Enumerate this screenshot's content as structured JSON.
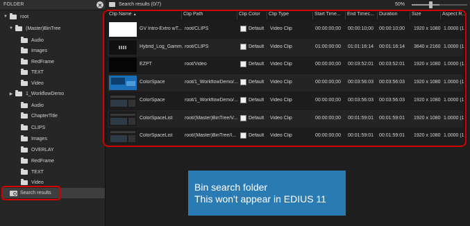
{
  "folder_panel": {
    "title": "FOLDER",
    "tree": [
      {
        "label": "root",
        "arrow": "▼"
      },
      {
        "label": "(Master)BinTree",
        "arrow": "▼"
      },
      {
        "label": "Audio",
        "arrow": ""
      },
      {
        "label": "Images",
        "arrow": ""
      },
      {
        "label": "RedFrame",
        "arrow": ""
      },
      {
        "label": "TEXT",
        "arrow": ""
      },
      {
        "label": "Video",
        "arrow": ""
      },
      {
        "label": "1_WorkflowDemo",
        "arrow": "▶"
      },
      {
        "label": "Audio",
        "arrow": ""
      },
      {
        "label": "ChapterTitle",
        "arrow": ""
      },
      {
        "label": "CLIPS",
        "arrow": ""
      },
      {
        "label": "Images",
        "arrow": ""
      },
      {
        "label": "OVERLAY",
        "arrow": ""
      },
      {
        "label": "RedFrame",
        "arrow": ""
      },
      {
        "label": "TEXT",
        "arrow": ""
      },
      {
        "label": "Video",
        "arrow": ""
      }
    ],
    "search_results_label": "Search results"
  },
  "results": {
    "title": "Search results (0/7)",
    "zoom": "50%",
    "zoom_fraction": 0.5
  },
  "table": {
    "columns": [
      "Clip Name",
      "Clip Path",
      "Clip Color",
      "Clip Type",
      "Start Time...",
      "End Timec...",
      "Duration",
      "Size",
      "Aspect R..."
    ],
    "sort_indicator": "▲",
    "rows": [
      {
        "thumb": "white",
        "name": "GV Intro-Extro wT...",
        "path": "root/CLIPS",
        "color": "Default",
        "type": "Video Clip",
        "start": "00:00:00;00",
        "end": "00:00:10;00",
        "duration": "00:00:10;00",
        "size": "1920 x 1080",
        "aspect": "1.0000 (1..."
      },
      {
        "thumb": "dark",
        "name": "Hybrid_Log_Gamm...",
        "path": "root/CLIPS",
        "color": "Default",
        "type": "Video Clip",
        "start": "01:00:00:00",
        "end": "01:01:16:14",
        "duration": "00:01:16:14",
        "size": "3840 x 2160",
        "aspect": "1.0000 (1..."
      },
      {
        "thumb": "black",
        "name": "EZPT",
        "path": "root/Video",
        "color": "Default",
        "type": "Video Clip",
        "start": "00:00:00;00",
        "end": "00:03:52:01",
        "duration": "00:03:52:01",
        "size": "1920 x 1080",
        "aspect": "1.0000 (1..."
      },
      {
        "thumb": "blue",
        "name": "ColorSpace",
        "path": "root/1_WorkflowDemo/...",
        "color": "Default",
        "type": "Video Clip",
        "start": "00:00:00;00",
        "end": "00:03:56:03",
        "duration": "00:03:56:03",
        "size": "1920 x 1080",
        "aspect": "1.0000 (1..."
      },
      {
        "thumb": "ui",
        "name": "ColorSpace",
        "path": "root/1_WorkflowDemo/...",
        "color": "Default",
        "type": "Video Clip",
        "start": "00:00:00;00",
        "end": "00:03:56:03",
        "duration": "00:03:56:03",
        "size": "1920 x 1080",
        "aspect": "1.0000 (1..."
      },
      {
        "thumb": "ui",
        "name": "ColorSpaceList",
        "path": "root/(Master)BinTree/V...",
        "color": "Default",
        "type": "Video Clip",
        "start": "00:00:00;00",
        "end": "00:01:59:01",
        "duration": "00:01:59:01",
        "size": "1920 x 1080",
        "aspect": "1.0000 (1..."
      },
      {
        "thumb": "ui",
        "name": "ColorSpaceList",
        "path": "root/(Master)BinTree/I...",
        "color": "Default",
        "type": "Video Clip",
        "start": "00:00:00;00",
        "end": "00:01:59:01",
        "duration": "00:01:59:01",
        "size": "1920 x 1080",
        "aspect": "1.0000 (1..."
      }
    ]
  },
  "callout": {
    "line1": "Bin search folder",
    "line2": "This won't appear in EDIUS 11"
  },
  "colors": {
    "annotation": "#d40000",
    "callout_bg": "#2a7bb4"
  }
}
